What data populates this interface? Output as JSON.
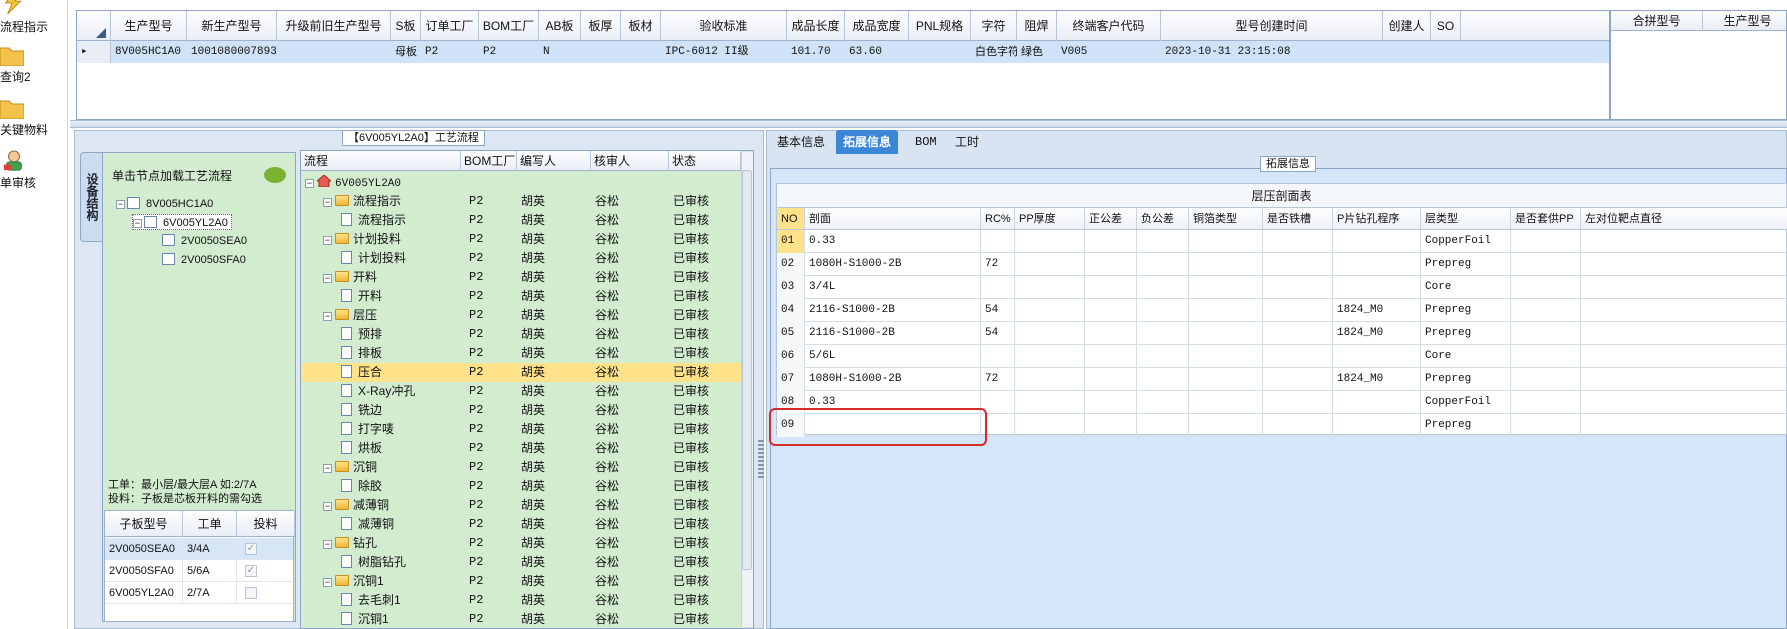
{
  "quickbar": {
    "items": [
      {
        "label": "流程指示",
        "icon": "lightning-icon"
      },
      {
        "label": "查询2",
        "icon": "folder-icon"
      },
      {
        "label": "关键物料",
        "icon": "folder-icon"
      },
      {
        "label": "单审核",
        "icon": "user-icon"
      }
    ]
  },
  "topgrid": {
    "headers": [
      "生产型号",
      "新生产型号",
      "升级前旧生产型号",
      "S板",
      "订单工厂",
      "BOM工厂",
      "AB板",
      "板厚",
      "板材",
      "验收标准",
      "成品长度",
      "成品宽度",
      "PNL规格",
      "字符",
      "阻焊",
      "终端客户代码",
      "型号创建时间",
      "创建人",
      "SO"
    ],
    "row": {
      "生产型号": "8V005HC1A0",
      "新生产型号": "10010800078936",
      "升级前旧生产型号": "",
      "S板": "母板",
      "订单工厂": "P2",
      "BOM工厂": "P2",
      "AB板": "N",
      "板厚": "",
      "板材": "",
      "验收标准": "IPC-6012 II级",
      "成品长度": "101.70",
      "成品宽度": "63.60",
      "PNL规格": "",
      "字符": "白色字符",
      "阻焊": "绿色",
      "终端客户代码": "V005",
      "型号创建时间": "2023-10-31 23:15:08",
      "创建人": "",
      "SO": ""
    },
    "right_headers": [
      "合拼型号",
      "生产型号"
    ]
  },
  "left": {
    "group_title": "【6V005YL2A0】工艺流程",
    "vtab": "设备结构",
    "tip": "单击节点加载工艺流程",
    "tree": [
      "8V005HC1A0",
      "6V005YL2A0",
      "2V0050SEA0",
      "2V0050SFA0"
    ],
    "info_line1": "工单：最小层/最大层A 如:2/7A",
    "info_line2": "投料：子板是芯板开料的需勾选",
    "subgrid_headers": [
      "子板型号",
      "工单",
      "投料"
    ],
    "subgrid_rows": [
      {
        "model": "2V0050SEA0",
        "order": "3/4A",
        "checked": true
      },
      {
        "model": "2V0050SFA0",
        "order": "5/6A",
        "checked": true
      },
      {
        "model": "6V005YL2A0",
        "order": "2/7A",
        "checked": false
      }
    ]
  },
  "process": {
    "headers": [
      "流程",
      "BOM工厂",
      "编写人",
      "核审人",
      "状态"
    ],
    "root": "6V005YL2A0",
    "rows": [
      {
        "name": "流程指示",
        "level": 1,
        "folder": true,
        "bom": "P2",
        "author": "胡英",
        "reviewer": "谷松",
        "status": "已审核"
      },
      {
        "name": "流程指示",
        "level": 2,
        "folder": false,
        "bom": "P2",
        "author": "胡英",
        "reviewer": "谷松",
        "status": "已审核"
      },
      {
        "name": "计划投料",
        "level": 1,
        "folder": true,
        "bom": "P2",
        "author": "胡英",
        "reviewer": "谷松",
        "status": "已审核"
      },
      {
        "name": "计划投料",
        "level": 2,
        "folder": false,
        "bom": "P2",
        "author": "胡英",
        "reviewer": "谷松",
        "status": "已审核"
      },
      {
        "name": "开料",
        "level": 1,
        "folder": true,
        "bom": "P2",
        "author": "胡英",
        "reviewer": "谷松",
        "status": "已审核"
      },
      {
        "name": "开料",
        "level": 2,
        "folder": false,
        "bom": "P2",
        "author": "胡英",
        "reviewer": "谷松",
        "status": "已审核"
      },
      {
        "name": "层压",
        "level": 1,
        "folder": true,
        "bom": "P2",
        "author": "胡英",
        "reviewer": "谷松",
        "status": "已审核"
      },
      {
        "name": "预排",
        "level": 2,
        "folder": false,
        "bom": "P2",
        "author": "胡英",
        "reviewer": "谷松",
        "status": "已审核"
      },
      {
        "name": "排板",
        "level": 2,
        "folder": false,
        "bom": "P2",
        "author": "胡英",
        "reviewer": "谷松",
        "status": "已审核"
      },
      {
        "name": "压合",
        "level": 2,
        "folder": false,
        "bom": "P2",
        "author": "胡英",
        "reviewer": "谷松",
        "status": "已审核",
        "selected": true
      },
      {
        "name": "X-Ray冲孔",
        "level": 2,
        "folder": false,
        "bom": "P2",
        "author": "胡英",
        "reviewer": "谷松",
        "status": "已审核"
      },
      {
        "name": "铣边",
        "level": 2,
        "folder": false,
        "bom": "P2",
        "author": "胡英",
        "reviewer": "谷松",
        "status": "已审核"
      },
      {
        "name": "打字唛",
        "level": 2,
        "folder": false,
        "bom": "P2",
        "author": "胡英",
        "reviewer": "谷松",
        "status": "已审核"
      },
      {
        "name": "烘板",
        "level": 2,
        "folder": false,
        "bom": "P2",
        "author": "胡英",
        "reviewer": "谷松",
        "status": "已审核"
      },
      {
        "name": "沉铜",
        "level": 1,
        "folder": true,
        "bom": "P2",
        "author": "胡英",
        "reviewer": "谷松",
        "status": "已审核"
      },
      {
        "name": "除胶",
        "level": 2,
        "folder": false,
        "bom": "P2",
        "author": "胡英",
        "reviewer": "谷松",
        "status": "已审核"
      },
      {
        "name": "减薄铜",
        "level": 1,
        "folder": true,
        "bom": "P2",
        "author": "胡英",
        "reviewer": "谷松",
        "status": "已审核"
      },
      {
        "name": "减薄铜",
        "level": 2,
        "folder": false,
        "bom": "P2",
        "author": "胡英",
        "reviewer": "谷松",
        "status": "已审核"
      },
      {
        "name": "钻孔",
        "level": 1,
        "folder": true,
        "bom": "P2",
        "author": "胡英",
        "reviewer": "谷松",
        "status": "已审核"
      },
      {
        "name": "树脂钻孔",
        "level": 2,
        "folder": false,
        "bom": "P2",
        "author": "胡英",
        "reviewer": "谷松",
        "status": "已审核"
      },
      {
        "name": "沉铜1",
        "level": 1,
        "folder": true,
        "bom": "P2",
        "author": "胡英",
        "reviewer": "谷松",
        "status": "已审核"
      },
      {
        "name": "去毛刺1",
        "level": 2,
        "folder": false,
        "bom": "P2",
        "author": "胡英",
        "reviewer": "谷松",
        "status": "已审核"
      },
      {
        "name": "沉铜1",
        "level": 2,
        "folder": false,
        "bom": "P2",
        "author": "胡英",
        "reviewer": "谷松",
        "status": "已审核"
      }
    ]
  },
  "right": {
    "tabs": [
      "基本信息",
      "拓展信息",
      "BOM",
      "工时"
    ],
    "active_tab": "拓展信息",
    "group_title": "拓展信息",
    "table_title": "层压剖面表",
    "headers": [
      "NO",
      "剖面",
      "RC%",
      "PP厚度",
      "正公差",
      "负公差",
      "铜箔类型",
      "是否铁槽",
      "P片钻孔程序",
      "层类型",
      "是否套供PP",
      "左对位靶点直径"
    ],
    "rows": [
      {
        "no": "01",
        "section": "0.33",
        "rc": "",
        "drill": "",
        "layer": "CopperFoil"
      },
      {
        "no": "02",
        "section": "1080H-S1000-2B",
        "rc": "72",
        "drill": "",
        "layer": "Prepreg"
      },
      {
        "no": "03",
        "section": "3/4L",
        "rc": "",
        "drill": "",
        "layer": "Core"
      },
      {
        "no": "04",
        "section": "2116-S1000-2B",
        "rc": "54",
        "drill": "1824_M0",
        "layer": "Prepreg"
      },
      {
        "no": "05",
        "section": "2116-S1000-2B",
        "rc": "54",
        "drill": "1824_M0",
        "layer": "Prepreg"
      },
      {
        "no": "06",
        "section": "5/6L",
        "rc": "",
        "drill": "",
        "layer": "Core"
      },
      {
        "no": "07",
        "section": "1080H-S1000-2B",
        "rc": "72",
        "drill": "1824_M0",
        "layer": "Prepreg"
      },
      {
        "no": "08",
        "section": "0.33",
        "rc": "",
        "drill": "",
        "layer": "CopperFoil"
      },
      {
        "no": "09",
        "section": "",
        "rc": "",
        "drill": "",
        "layer": "Prepreg"
      }
    ]
  },
  "colors": {
    "selected_row": "#cfe2f7",
    "highlight_row": "#ffe28a",
    "active_tab": "#3c86d8",
    "annotation": "#d62b2b"
  }
}
